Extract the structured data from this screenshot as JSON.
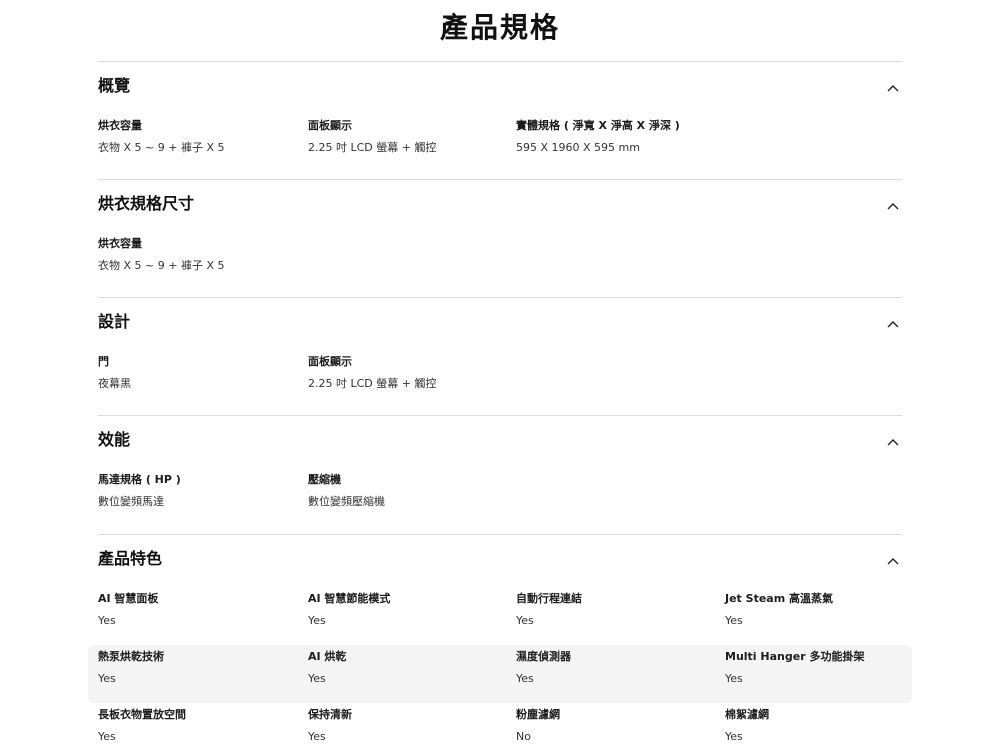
{
  "page": {
    "title": "產品規格"
  },
  "sections": [
    {
      "title": "概覽",
      "rows": [
        [
          {
            "label": "烘衣容量",
            "value": "衣物 X 5 ~ 9 + 褲子 X 5"
          },
          {
            "label": "面板顯示",
            "value": "2.25 吋 LCD 螢幕 + 觸控"
          },
          {
            "label": "實體規格 ( 淨寬 X 淨高 X 淨深 )",
            "value": "595 X 1960 X 595 mm"
          }
        ]
      ]
    },
    {
      "title": "烘衣規格尺寸",
      "rows": [
        [
          {
            "label": "烘衣容量",
            "value": "衣物 X 5 ~ 9 + 褲子 X 5"
          }
        ]
      ]
    },
    {
      "title": "設計",
      "rows": [
        [
          {
            "label": "門",
            "value": "夜幕黑"
          },
          {
            "label": "面板顯示",
            "value": "2.25 吋 LCD 螢幕 + 觸控"
          }
        ]
      ]
    },
    {
      "title": "效能",
      "rows": [
        [
          {
            "label": "馬達規格 ( HP )",
            "value": "數位變頻馬達"
          },
          {
            "label": "壓縮機",
            "value": "數位變頻壓縮機"
          }
        ]
      ]
    },
    {
      "title": "產品特色",
      "rows": [
        [
          {
            "label": "AI 智慧面板",
            "value": "Yes"
          },
          {
            "label": "AI 智慧節能模式",
            "value": "Yes"
          },
          {
            "label": "自動行程連結",
            "value": "Yes"
          },
          {
            "label": "Jet Steam 高溫蒸氣",
            "value": "Yes"
          }
        ],
        [
          {
            "label": "熱泵烘乾技術",
            "value": "Yes"
          },
          {
            "label": "AI 烘乾",
            "value": "Yes"
          },
          {
            "label": "濕度偵測器",
            "value": "Yes"
          },
          {
            "label": "Multi Hanger 多功能掛架",
            "value": "Yes"
          }
        ],
        [
          {
            "label": "長板衣物置放空間",
            "value": "Yes"
          },
          {
            "label": "保持清新",
            "value": "Yes"
          },
          {
            "label": "粉塵濾網",
            "value": "No"
          },
          {
            "label": "棉絮濾網",
            "value": "Yes"
          }
        ]
      ]
    }
  ]
}
